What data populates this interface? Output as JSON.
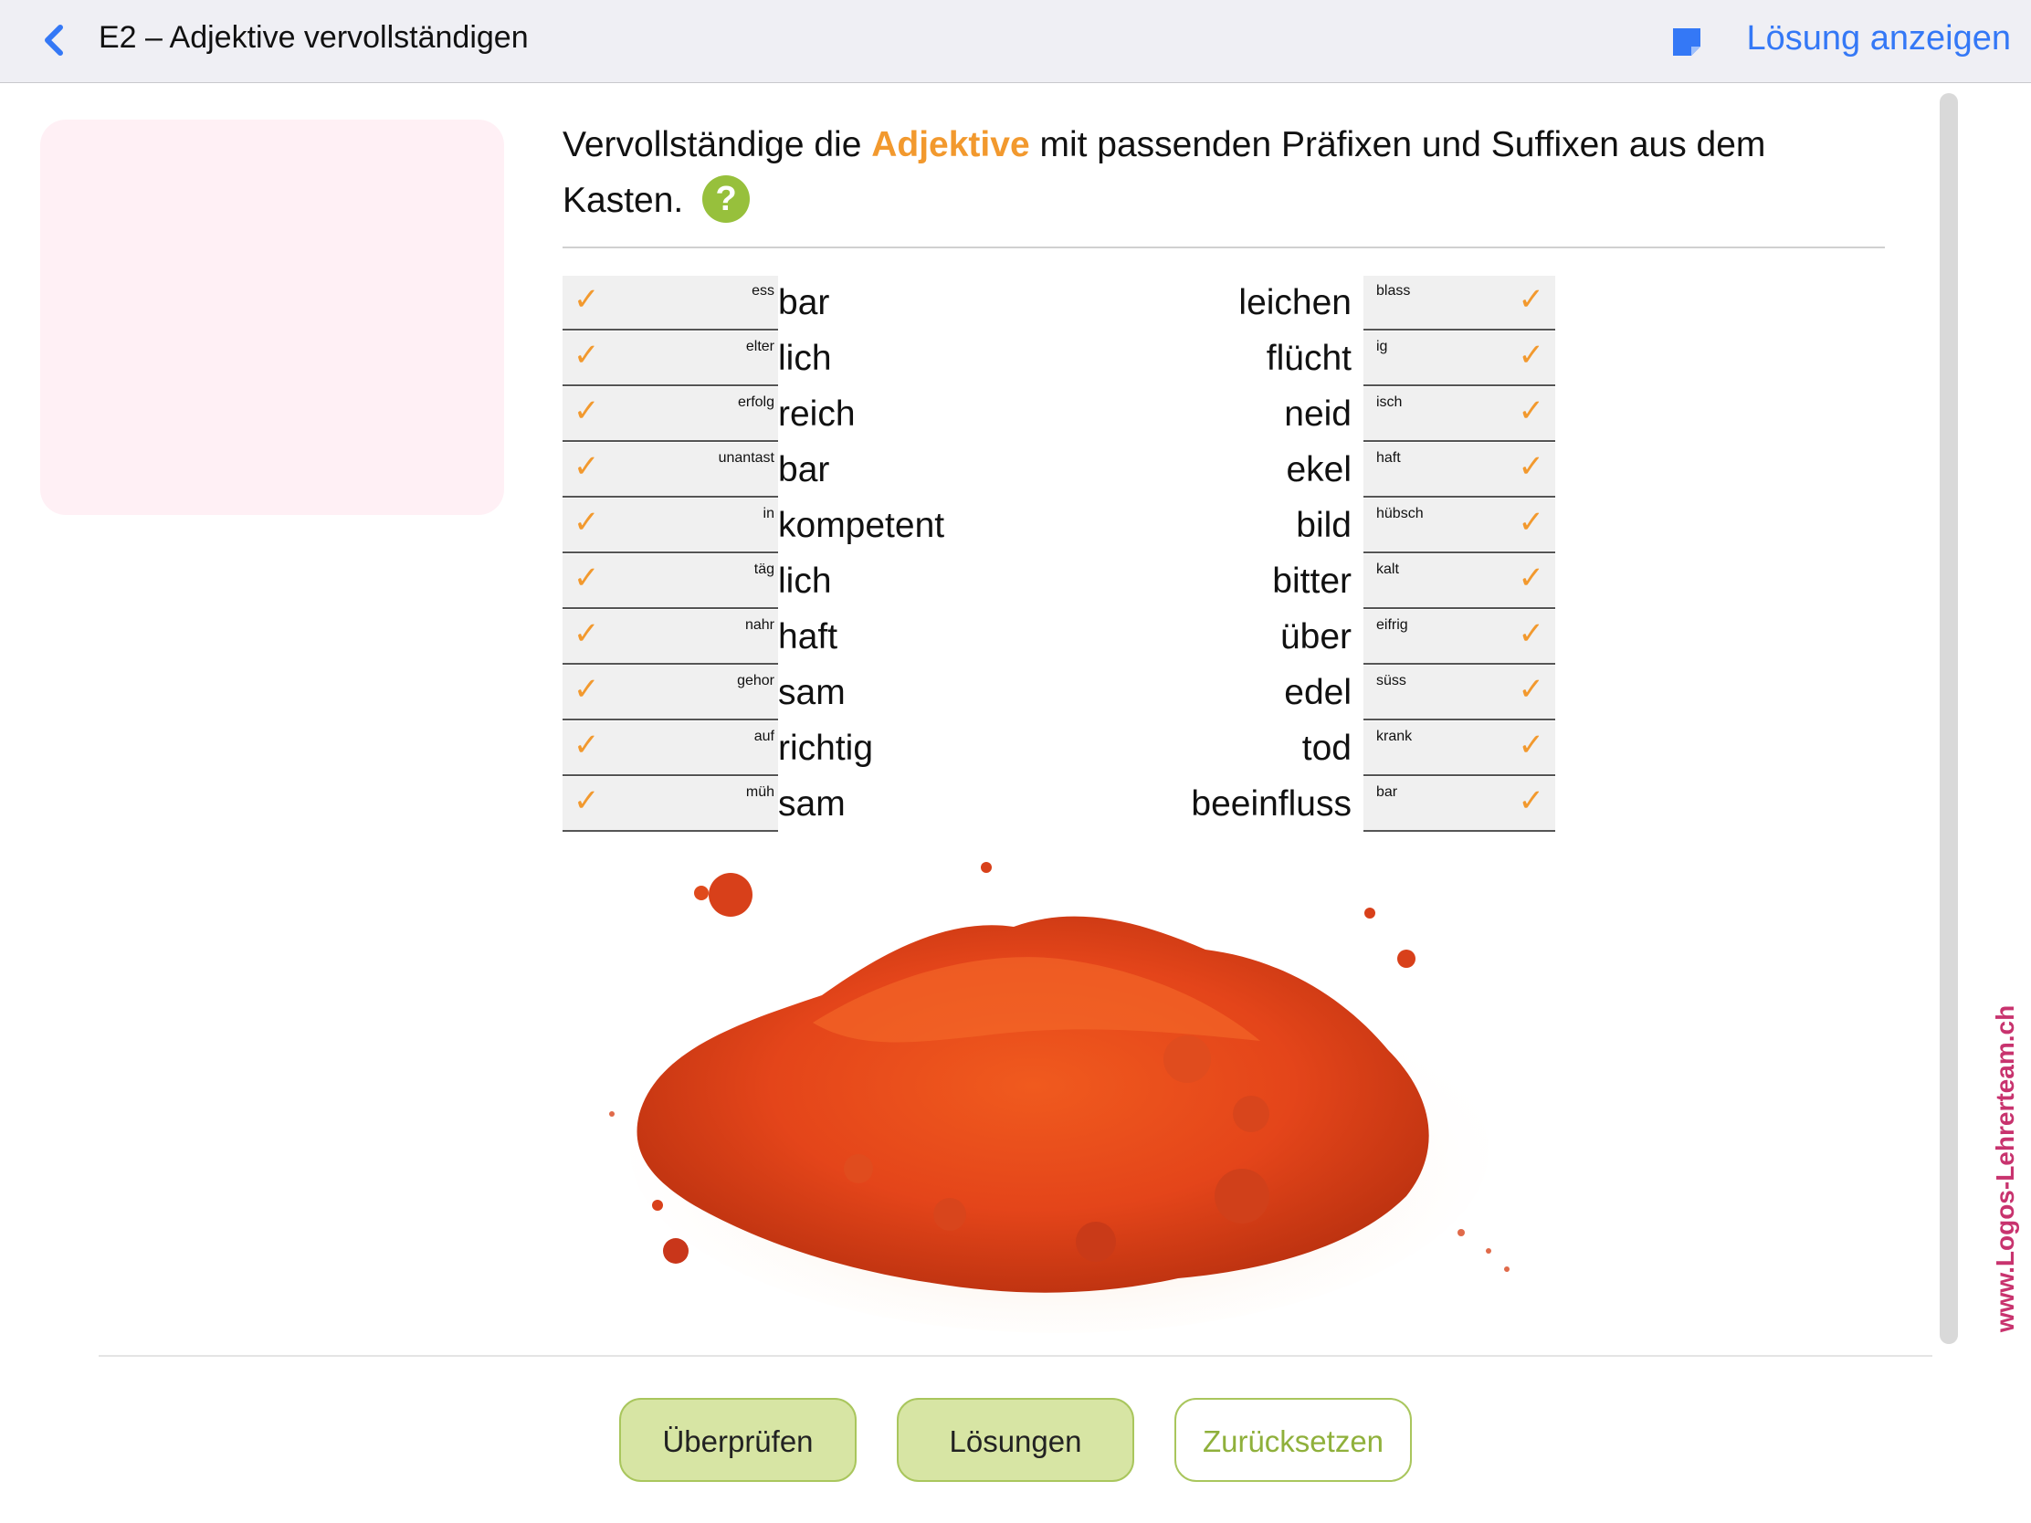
{
  "header": {
    "back_icon": "chevron-left-icon",
    "title": "E2 – Adjektive vervollständigen",
    "note_icon": "note-icon",
    "solution_link": "Lösung anzeigen"
  },
  "task": {
    "instruction_before": "Vervollständige die ",
    "keyword": "Adjektive",
    "instruction_after": " mit passenden Präfixen und Suffixen aus dem Kasten.",
    "help_symbol": "?"
  },
  "left_items": [
    {
      "fill": "ess",
      "stem": "bar",
      "check": "✓"
    },
    {
      "fill": "elter",
      "stem": "lich",
      "check": "✓"
    },
    {
      "fill": "erfolg",
      "stem": "reich",
      "check": "✓"
    },
    {
      "fill": "unantast",
      "stem": "bar",
      "check": "✓"
    },
    {
      "fill": "in",
      "stem": "kompetent",
      "check": "✓"
    },
    {
      "fill": "täg",
      "stem": "lich",
      "check": "✓"
    },
    {
      "fill": "nahr",
      "stem": "haft",
      "check": "✓"
    },
    {
      "fill": "gehor",
      "stem": "sam",
      "check": "✓"
    },
    {
      "fill": "auf",
      "stem": "richtig",
      "check": "✓"
    },
    {
      "fill": "müh",
      "stem": "sam",
      "check": "✓"
    }
  ],
  "right_items": [
    {
      "stem": "leichen",
      "fill": "blass",
      "check": "✓"
    },
    {
      "stem": "flücht",
      "fill": "ig",
      "check": "✓"
    },
    {
      "stem": "neid",
      "fill": "isch",
      "check": "✓"
    },
    {
      "stem": "ekel",
      "fill": "haft",
      "check": "✓"
    },
    {
      "stem": "bild",
      "fill": "hübsch",
      "check": "✓"
    },
    {
      "stem": "bitter",
      "fill": "kalt",
      "check": "✓"
    },
    {
      "stem": "über",
      "fill": "eifrig",
      "check": "✓"
    },
    {
      "stem": "edel",
      "fill": "süss",
      "check": "✓"
    },
    {
      "stem": "tod",
      "fill": "krank",
      "check": "✓"
    },
    {
      "stem": "beeinfluss",
      "fill": "bar",
      "check": "✓"
    }
  ],
  "buttons": {
    "check": "Überprüfen",
    "solutions": "Lösungen",
    "reset": "Zurücksetzen"
  },
  "watermark": "www.Logos-Lehrerteam.ch",
  "colors": {
    "accent_blue": "#3478f6",
    "keyword_orange": "#f2992e",
    "help_green": "#97c03c",
    "button_green": "#d7e5a4",
    "pink_panel": "#fff0f5",
    "watermark_pink": "#c8336e"
  }
}
